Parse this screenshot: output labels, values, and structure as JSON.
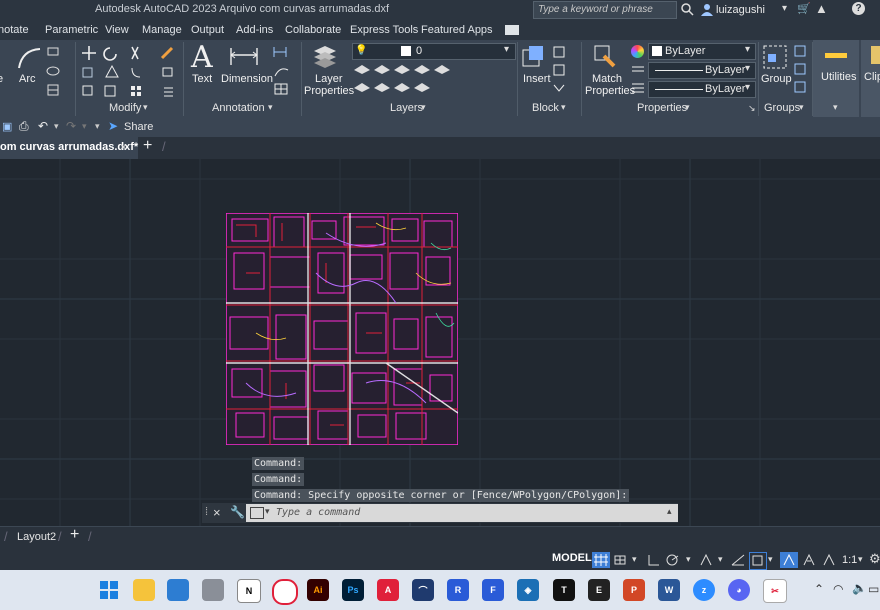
{
  "window": {
    "title": "Autodesk AutoCAD 2023   Arquivo com curvas arrumadas.dxf",
    "search_placeholder": "Type a keyword or phrase",
    "user": "luizagushi"
  },
  "menu_tabs": [
    "notate",
    "Parametric",
    "View",
    "Manage",
    "Output",
    "Add-ins",
    "Collaborate",
    "Express Tools",
    "Featured Apps"
  ],
  "ribbon": {
    "draw": {
      "arc_label": "Arc",
      "e_label": "e"
    },
    "modify": {
      "title": "Modify"
    },
    "annotation": {
      "title": "Annotation",
      "text_label": "Text",
      "dimension_label": "Dimension"
    },
    "layers": {
      "title": "Layers",
      "layer_props_line1": "Layer",
      "layer_props_line2": "Properties",
      "current_layer": "0"
    },
    "block": {
      "title": "Block",
      "insert_label": "Insert"
    },
    "properties": {
      "title": "Properties",
      "match_line1": "Match",
      "match_line2": "Properties",
      "color": "ByLayer",
      "linetype": "ByLayer",
      "lineweight": "ByLayer"
    },
    "groups": {
      "title": "Groups",
      "group_label": "Group"
    },
    "utilities": {
      "label": "Utilities"
    },
    "clipboard": {
      "label": "Clip"
    }
  },
  "quick_access": {
    "share_label": "Share"
  },
  "file_tab": {
    "label": "om curvas arrumadas.dxf*"
  },
  "command_history": [
    "Command:",
    "Command:",
    "Command: Specify opposite corner or [Fence/WPolygon/CPolygon]:"
  ],
  "command_input": {
    "placeholder": "Type a command"
  },
  "layout_tabs": {
    "current": "Layout2"
  },
  "status": {
    "model": "MODEL",
    "scale": "1:1"
  },
  "colors": {
    "ribbon_bg": "#3a4553",
    "canvas_bg": "#212830",
    "drawing_magenta": "#ff2ad4",
    "drawing_red": "#e0203a"
  }
}
